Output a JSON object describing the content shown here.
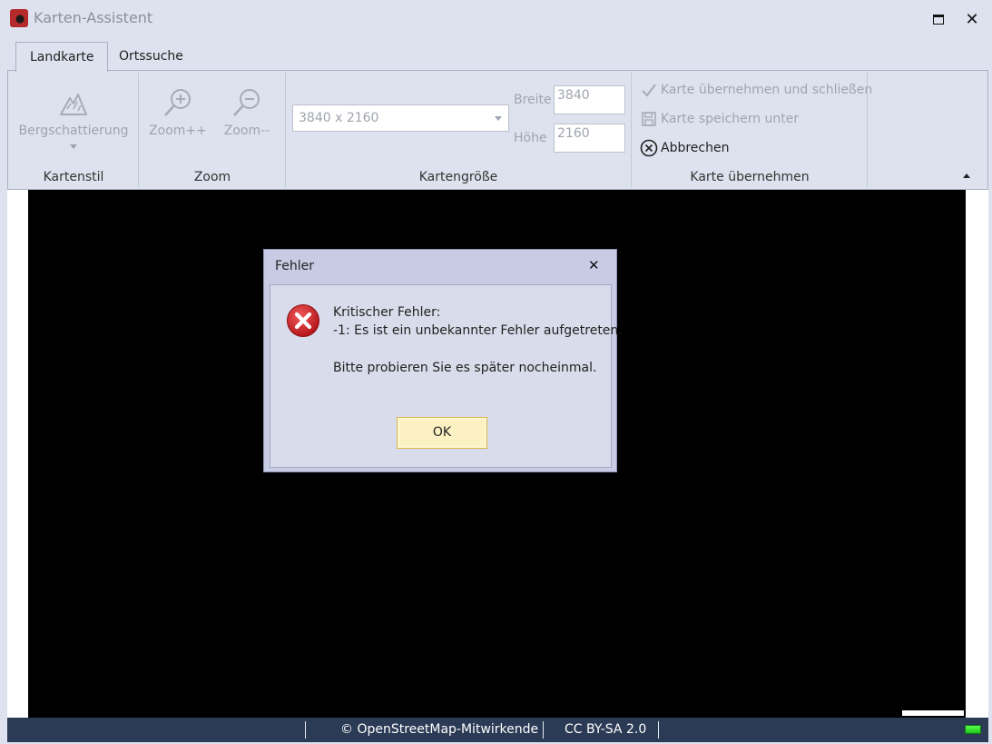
{
  "window": {
    "title": "Karten-Assistent"
  },
  "tabs": [
    {
      "label": "Landkarte",
      "active": true
    },
    {
      "label": "Ortssuche",
      "active": false
    }
  ],
  "ribbon": {
    "kartenstil": {
      "label": "Kartenstil",
      "button": "Bergschattierung"
    },
    "zoom": {
      "label": "Zoom",
      "zoom_in": "Zoom++",
      "zoom_out": "Zoom--"
    },
    "kartengroesse": {
      "label": "Kartengröße",
      "preset_value": "3840 x 2160",
      "width_label": "Breite",
      "width_value": "3840",
      "height_label": "Höhe",
      "height_value": "2160"
    },
    "karte_uebernehmen": {
      "label": "Karte übernehmen",
      "apply_close": "Karte übernehmen und schließen",
      "save_as": "Karte speichern unter",
      "cancel": "Abbrechen"
    }
  },
  "statusbar": {
    "attribution": "© OpenStreetMap-Mitwirkende",
    "license": "CC BY-SA 2.0"
  },
  "dialog": {
    "title": "Fehler",
    "line1": "Kritischer Fehler:",
    "line2": "-1: Es ist ein unbekannter Fehler aufgetreten.",
    "line3": "Bitte probieren Sie es später nocheinmal.",
    "ok_label": "OK"
  },
  "colors": {
    "background": "#dde2ee",
    "statusbar": "#2b3a55",
    "map": "#000000",
    "dialog_title": "#c8cbe4",
    "ok_button": "#fbf1c2",
    "error_red": "#d9262b"
  }
}
